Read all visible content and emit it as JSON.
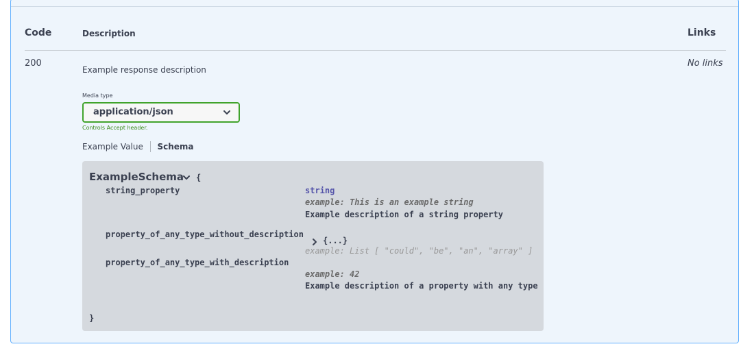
{
  "headers": {
    "code": "Code",
    "description": "Description",
    "links": "Links"
  },
  "response": {
    "code": "200",
    "description": "Example response description",
    "links": "No links"
  },
  "media_type": {
    "label": "Media type",
    "selected": "application/json",
    "hint": "Controls Accept header."
  },
  "tabs": {
    "example_value": "Example Value",
    "schema": "Schema",
    "active": "Schema"
  },
  "schema": {
    "name": "ExampleSchema",
    "open_brace": "{",
    "close_brace": "}",
    "properties": [
      {
        "name": "string_property",
        "type": "string",
        "example": "example: This is an example string",
        "description": "Example description of a string property"
      },
      {
        "name": "property_of_any_type_without_description",
        "collapsed_object": "{...}",
        "example": "example: List [ \"could\", \"be\", \"an\", \"array\" ]"
      },
      {
        "name": "property_of_any_type_with_description",
        "example": "example: 42",
        "description": "Example description of a property with any type"
      }
    ]
  },
  "icons": {
    "select": "chevron-down-icon",
    "schema_toggle": "chevron-down-icon",
    "expand": "chevron-right-icon"
  },
  "colors": {
    "panel_bg": "#eef5fc",
    "panel_border": "#61affe",
    "select_border": "#41a32c",
    "schema_bg": "#d5d9de",
    "type_color": "#5555aa"
  }
}
